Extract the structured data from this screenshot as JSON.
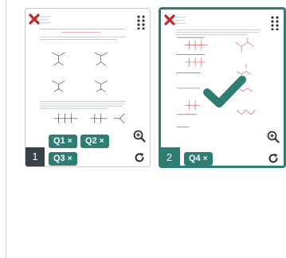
{
  "colors": {
    "teal": "#2e7d72",
    "dark_badge": "#36414a",
    "close_red": "#c0272d",
    "border": "#c9cdd1"
  },
  "pages": [
    {
      "number": "1",
      "tags": [
        {
          "label": "Q1",
          "remove": "×"
        },
        {
          "label": "Q2",
          "remove": "×"
        },
        {
          "label": "Q3",
          "remove": "×"
        }
      ],
      "icons": [
        "close-icon",
        "drag-handle-icon",
        "zoom-in-icon",
        "rotate-icon"
      ],
      "selected": false
    },
    {
      "number": "2",
      "tags": [
        {
          "label": "Q4",
          "remove": "×"
        }
      ],
      "icons": [
        "close-icon",
        "drag-handle-icon",
        "zoom-in-icon",
        "rotate-icon",
        "checkmark-icon"
      ],
      "selected": true
    }
  ]
}
